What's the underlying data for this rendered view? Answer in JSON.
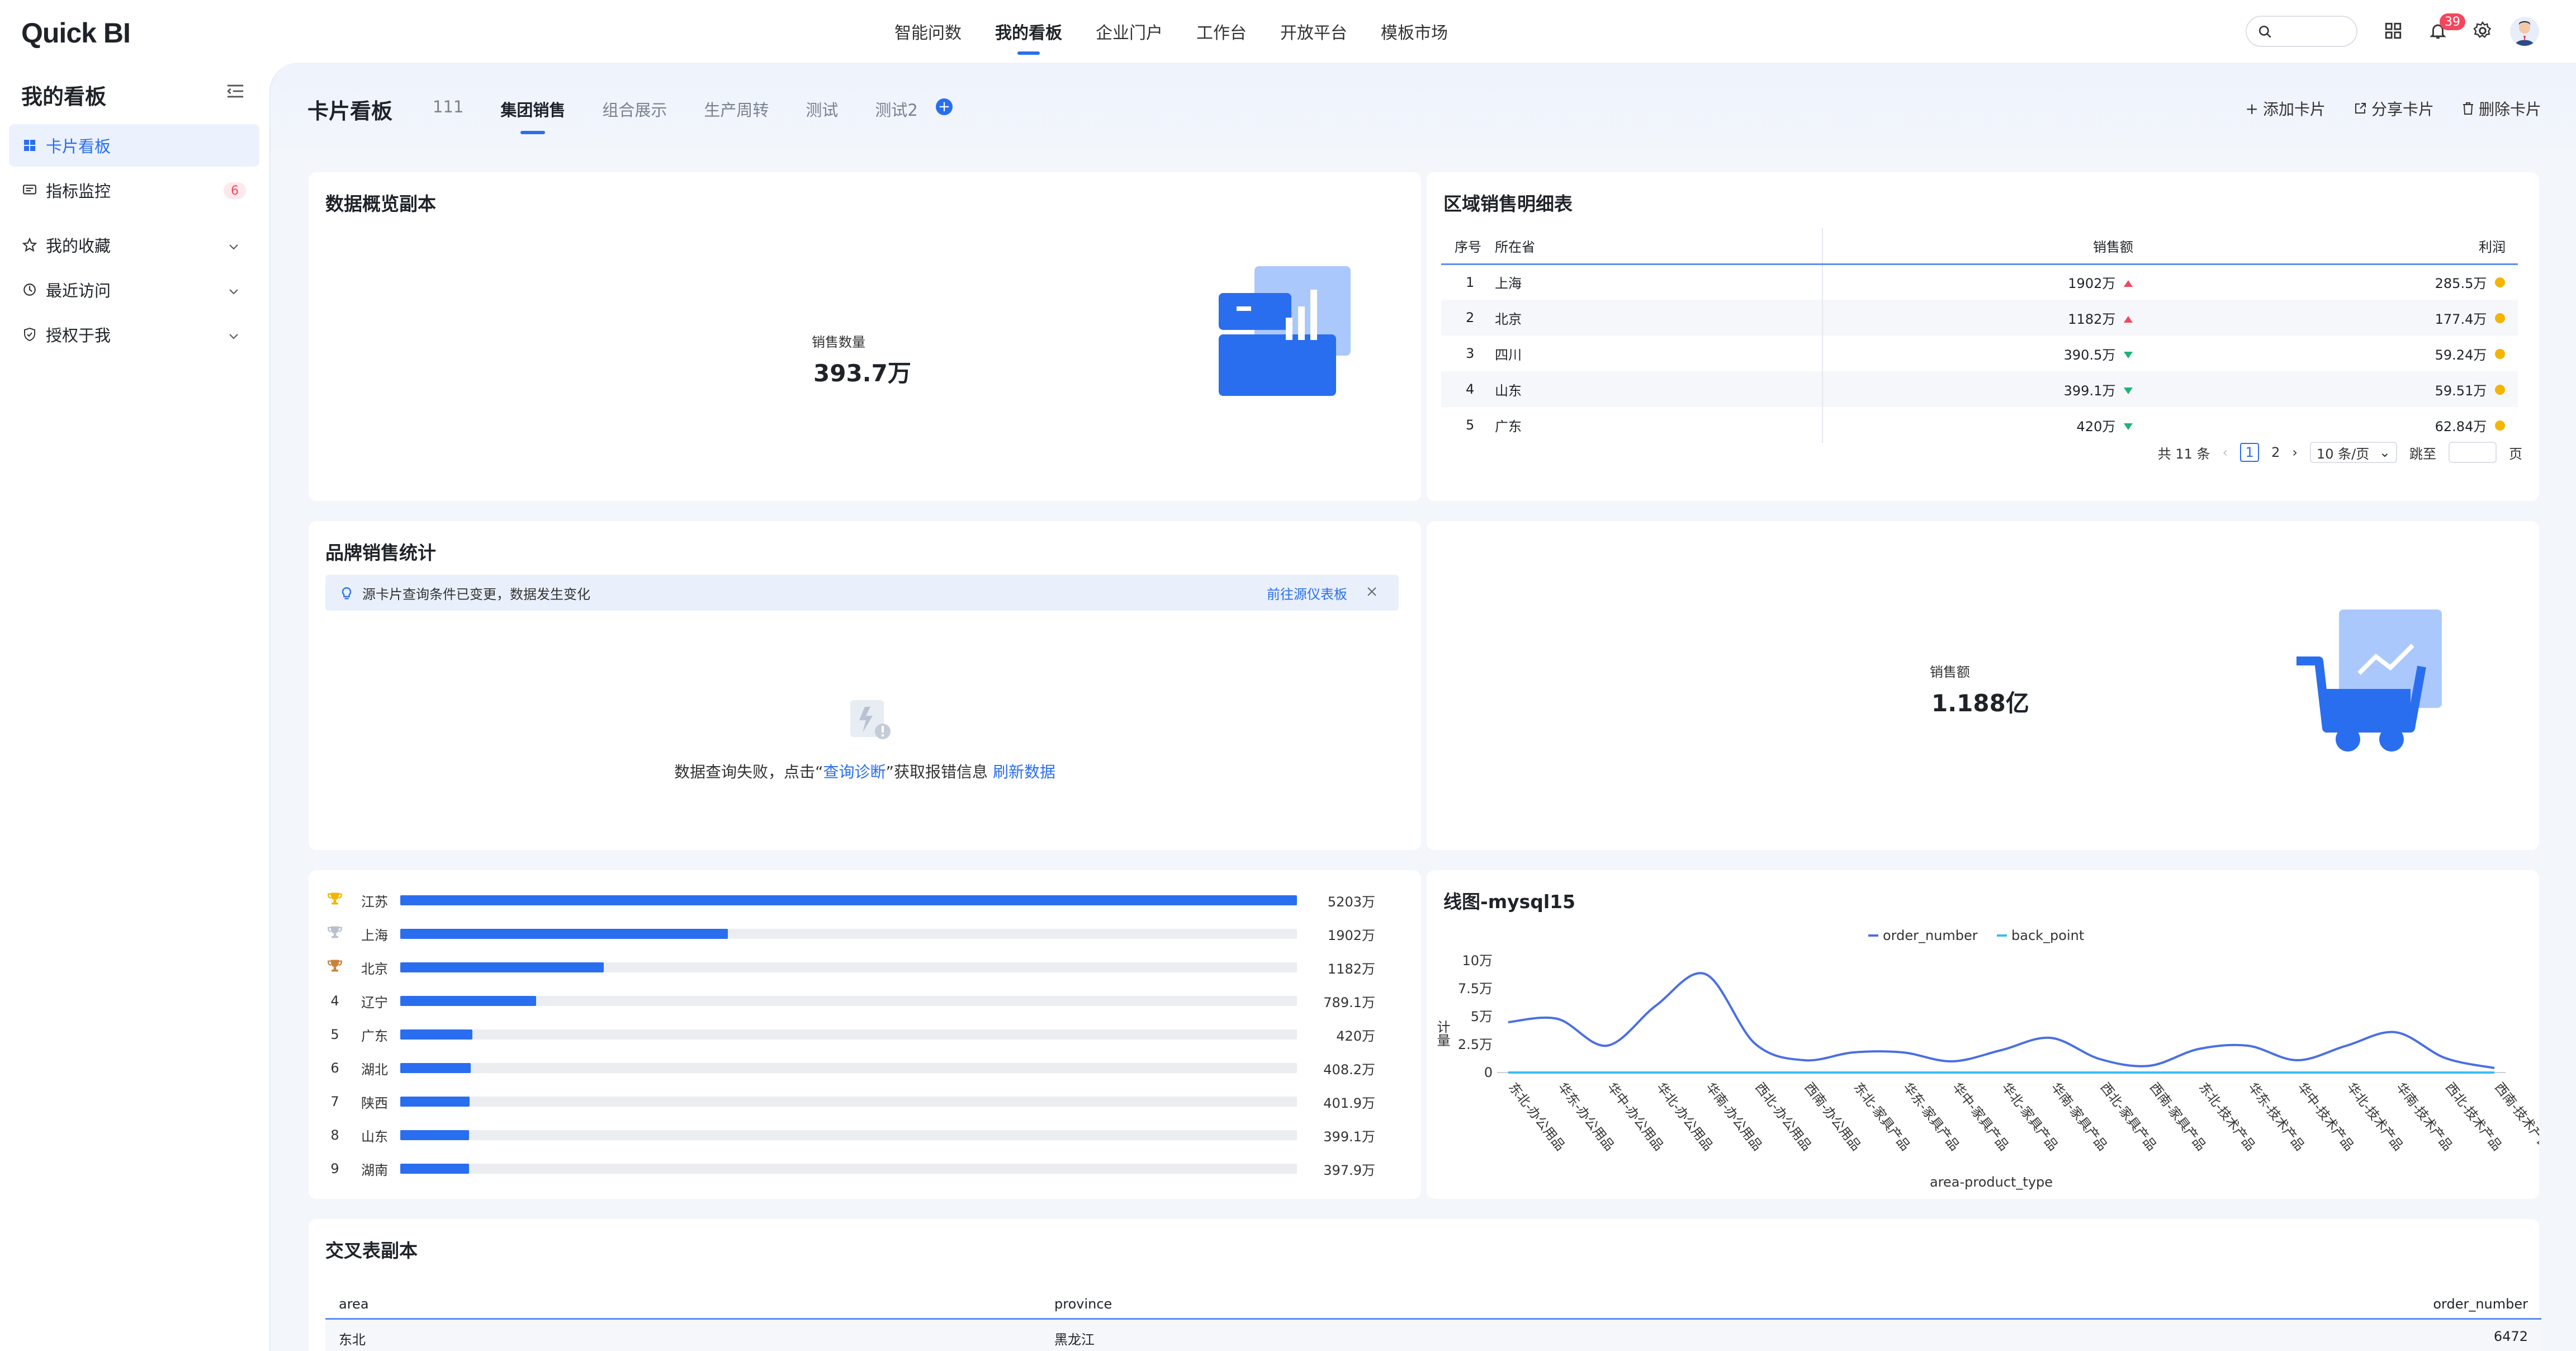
{
  "app": {
    "logo": "Quick BI"
  },
  "topnav": [
    "智能问数",
    "我的看板",
    "企业门户",
    "工作台",
    "开放平台",
    "模板市场"
  ],
  "notifications": {
    "count": "39"
  },
  "sidebar": {
    "title": "我的看板",
    "items": [
      {
        "label": "卡片看板"
      },
      {
        "label": "指标监控",
        "badge": "6"
      },
      {
        "label": "我的收藏"
      },
      {
        "label": "最近访问"
      },
      {
        "label": "授权于我"
      }
    ]
  },
  "board": {
    "title": "卡片看板",
    "tabs": [
      "111",
      "集团销售",
      "组合展示",
      "生产周转",
      "测试",
      "测试2"
    ],
    "active_tab": "集团销售",
    "actions": [
      "添加卡片",
      "分享卡片",
      "删除卡片"
    ]
  },
  "overview_card": {
    "title": "数据概览副本",
    "label": "销售数量",
    "value": "393.7万"
  },
  "region_table": {
    "title": "区域销售明细表",
    "columns": [
      "序号",
      "所在省",
      "销售额",
      "利润"
    ],
    "rows": [
      {
        "no": "1",
        "province": "上海",
        "sales": "1902万",
        "trend": "up",
        "profit": "285.5万"
      },
      {
        "no": "2",
        "province": "北京",
        "sales": "1182万",
        "trend": "up",
        "profit": "177.4万"
      },
      {
        "no": "3",
        "province": "四川",
        "sales": "390.5万",
        "trend": "down",
        "profit": "59.24万"
      },
      {
        "no": "4",
        "province": "山东",
        "sales": "399.1万",
        "trend": "down",
        "profit": "59.51万"
      },
      {
        "no": "5",
        "province": "广东",
        "sales": "420万",
        "trend": "down",
        "profit": "62.84万"
      }
    ],
    "pager": {
      "total": "共 11 条",
      "pages": [
        "1",
        "2"
      ],
      "page_size": "10 条/页",
      "goto": "跳至",
      "page_unit": "页"
    }
  },
  "brand_card": {
    "title": "品牌销售统计",
    "notice": "源卡片查询条件已变更，数据发生变化",
    "notice_link": "前往源仪表板",
    "error_prefix": "数据查询失败，点击“",
    "error_link1": "查询诊断",
    "error_middle": "”获取报错信息",
    "error_link2": "刷新数据"
  },
  "sales_card": {
    "label": "销售额",
    "value": "1.188亿"
  },
  "ranking": {
    "max": 5203,
    "rows": [
      {
        "rank": "1",
        "name": "江苏",
        "value": 5203,
        "label": "5203万"
      },
      {
        "rank": "2",
        "name": "上海",
        "value": 1902,
        "label": "1902万"
      },
      {
        "rank": "3",
        "name": "北京",
        "value": 1182,
        "label": "1182万"
      },
      {
        "rank": "4",
        "name": "辽宁",
        "value": 789.1,
        "label": "789.1万"
      },
      {
        "rank": "5",
        "name": "广东",
        "value": 420,
        "label": "420万"
      },
      {
        "rank": "6",
        "name": "湖北",
        "value": 408.2,
        "label": "408.2万"
      },
      {
        "rank": "7",
        "name": "陕西",
        "value": 401.9,
        "label": "401.9万"
      },
      {
        "rank": "8",
        "name": "山东",
        "value": 399.1,
        "label": "399.1万"
      },
      {
        "rank": "9",
        "name": "湖南",
        "value": 397.9,
        "label": "397.9万"
      }
    ]
  },
  "line_card": {
    "title": "线图-mysql15"
  },
  "chart_data": {
    "type": "line",
    "xlabel": "area-product_type",
    "ylabel": "计量",
    "ylim": [
      0,
      100000
    ],
    "yticks": [
      "0",
      "2.5万",
      "5万",
      "7.5万",
      "10万"
    ],
    "legend_position": "top-center",
    "categories": [
      "东北-办公用品",
      "华东-办公用品",
      "华中-办公用品",
      "华北-办公用品",
      "华南-办公用品",
      "西北-办公用品",
      "西南-办公用品",
      "东北-家具产品",
      "华东-家具产品",
      "华中-家具产品",
      "华北-家具产品",
      "华南-家具产品",
      "西北-家具产品",
      "西南-家具产品",
      "东北-技术产品",
      "华东-技术产品",
      "华中-技术产品",
      "华北-技术产品",
      "华南-技术产品",
      "西北-技术产品",
      "西南-技术产品"
    ],
    "series": [
      {
        "name": "order_number",
        "color": "#4a6fe3",
        "values": [
          45000,
          48000,
          24000,
          60000,
          88000,
          26000,
          11000,
          18000,
          18000,
          10000,
          20000,
          31000,
          12000,
          6000,
          21000,
          24000,
          11000,
          24000,
          36000,
          13000,
          4000
        ]
      },
      {
        "name": "back_point",
        "color": "#38bdf8",
        "values": [
          0,
          0,
          0,
          0,
          0,
          0,
          0,
          0,
          0,
          0,
          0,
          0,
          0,
          0,
          0,
          0,
          0,
          0,
          0,
          0,
          0
        ]
      }
    ]
  },
  "cross_card": {
    "title": "交叉表副本",
    "columns": [
      "area",
      "province",
      "order_number"
    ],
    "rows": [
      {
        "area": "东北",
        "province": "黑龙江",
        "order_number": "6472"
      }
    ]
  },
  "colors": {
    "accent": "#2a6ef0",
    "up": "#f5465d",
    "down": "#1fb374",
    "profit_dot": "#f5b400"
  }
}
